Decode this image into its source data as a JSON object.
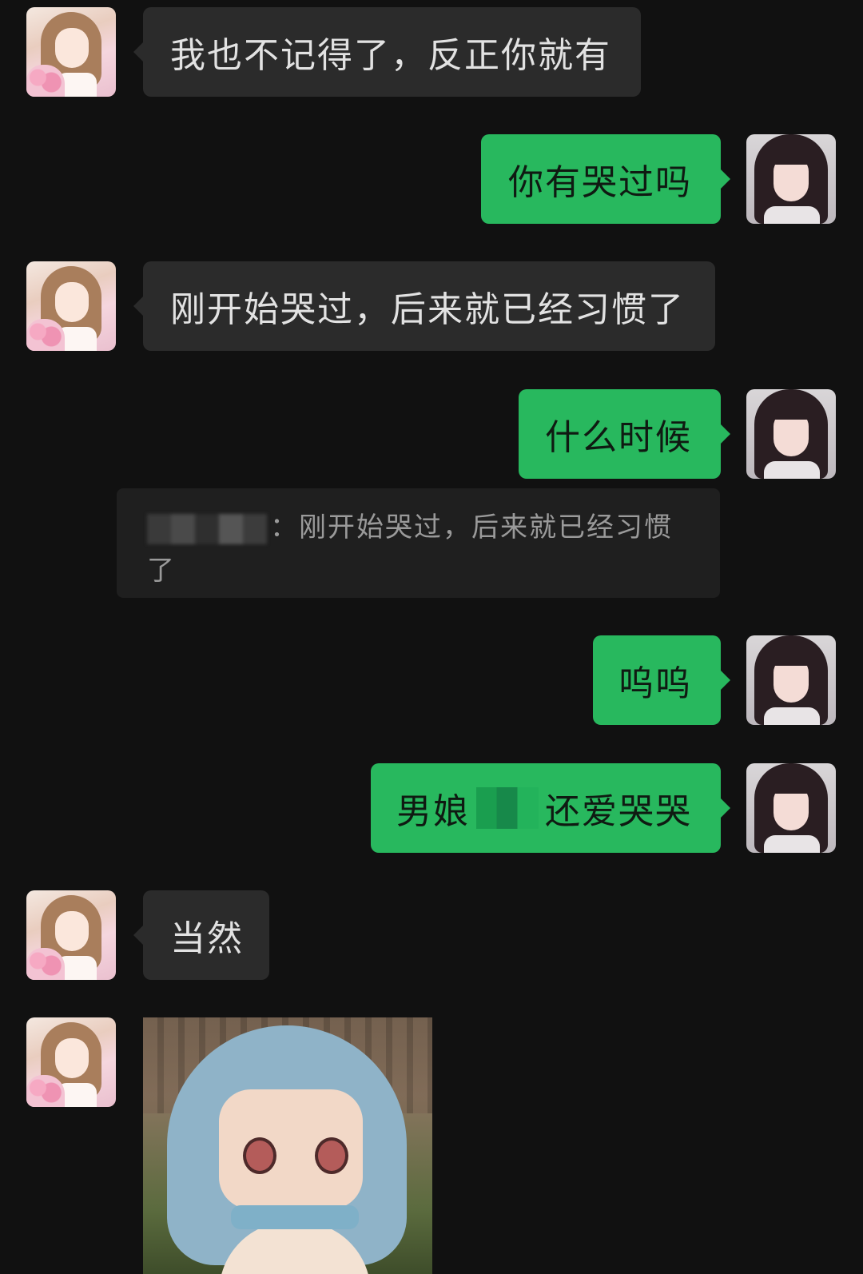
{
  "colors": {
    "background": "#111111",
    "incoming_bubble": "#2b2b2b",
    "outgoing_bubble": "#28b85e",
    "incoming_text": "#e2e2e2",
    "outgoing_text": "#0f1a12",
    "quote_bg": "#1f1f1f",
    "quote_text": "#9a9a9a"
  },
  "messages": [
    {
      "sender": "other",
      "text": "我也不记得了，反正你就有"
    },
    {
      "sender": "self",
      "text": "你有哭过吗"
    },
    {
      "sender": "other",
      "text": "刚开始哭过，后来就已经习惯了"
    },
    {
      "sender": "self",
      "text": "什么时候"
    },
    {
      "sender": "self",
      "text": "呜呜"
    },
    {
      "sender": "self",
      "text_before": "男娘",
      "text_after": "还爱哭哭"
    },
    {
      "sender": "other",
      "text": "当然"
    },
    {
      "sender": "other",
      "type": "sticker",
      "icon": "crying-plush-sticker"
    }
  ],
  "quote": {
    "separator": "：",
    "text": "刚开始哭过，后来就已经习惯了"
  }
}
